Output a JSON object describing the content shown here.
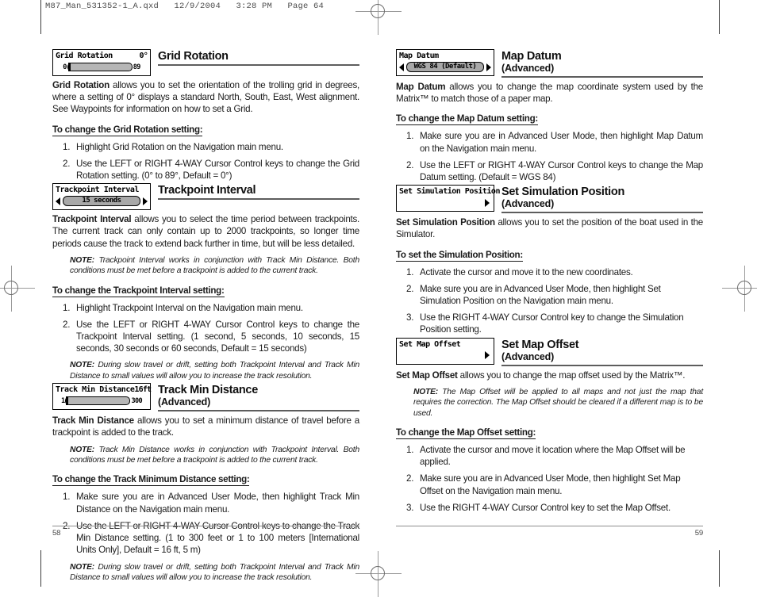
{
  "prepress": {
    "header": "M87_Man_531352-1_A.qxd   12/9/2004   3:28 PM   Page 64"
  },
  "left_page": {
    "page_number": "58",
    "sections": [
      {
        "heading": "Grid Rotation",
        "subheading": "",
        "lcd": {
          "type": "slider",
          "label": "Grid Rotation",
          "value": "0°",
          "min": "0",
          "max": "89"
        },
        "body": [
          "Grid Rotation allows you to set the orientation of the trolling grid in degrees, where a setting of 0° displays a standard North, South, East, West alignment. See Waypoints for information on how to set a Grid."
        ],
        "body_bold_lead": "Grid Rotation",
        "notes_before_procedure": [],
        "procedure_title": "To change the Grid Rotation setting:",
        "steps": [
          "Highlight Grid Rotation on the Navigation main menu.",
          "Use the LEFT or RIGHT 4-WAY Cursor Control keys to change the Grid Rotation setting. (0° to 89°, Default = 0°)"
        ],
        "notes_after": []
      },
      {
        "heading": "Trackpoint Interval",
        "subheading": "",
        "lcd": {
          "type": "select",
          "label": "Trackpoint Interval",
          "value": "15 seconds"
        },
        "body": [
          "Trackpoint Interval allows you to select the time period between trackpoints.  The current track can only contain up to 2000 trackpoints, so longer time periods cause the track to extend back further in time, but will be less detailed."
        ],
        "body_bold_lead": "Trackpoint Interval",
        "notes_before_procedure": [
          "NOTE: Trackpoint Interval works in conjunction with Track Min Distance.  Both conditions must be met before a trackpoint is added to the current track."
        ],
        "procedure_title": "To change the Trackpoint Interval setting:",
        "steps": [
          "Highlight Trackpoint Interval on the Navigation main menu.",
          "Use the LEFT or RIGHT 4-WAY Cursor Control keys to change the Trackpoint Interval setting. (1 second, 5 seconds, 10 seconds, 15 seconds, 30 seconds or 60 seconds, Default = 15 seconds)"
        ],
        "notes_after": [
          "NOTE: During slow travel or drift, setting both Trackpoint Interval and Track Min Distance to small values will allow you to increase the track resolution."
        ]
      },
      {
        "heading": "Track Min Distance",
        "subheading": "(Advanced)",
        "lcd": {
          "type": "slider",
          "label": "Track Min Distance",
          "value": "16ft",
          "min": "1",
          "max": "300"
        },
        "body": [
          "Track Min Distance allows you to set a minimum distance of travel before a trackpoint is added to the track."
        ],
        "body_bold_lead": "Track Min Distance",
        "notes_before_procedure": [
          "NOTE: Track Min Distance works in conjunction with Trackpoint Interval.  Both conditions must be met before a trackpoint is added to the current track."
        ],
        "procedure_title": "To change the Track Minimum Distance setting:",
        "steps": [
          "Make sure you are in Advanced User Mode, then highlight Track Min Distance on the Navigation main menu.",
          "Use the LEFT or RIGHT 4-WAY Cursor Control keys to change the Track Min Distance setting. (1 to 300 feet or 1 to 100 meters [International Units Only], Default = 16 ft, 5 m)"
        ],
        "notes_after": [
          "NOTE: During slow travel or drift, setting both Trackpoint Interval and Track Min Distance to small values will allow you to increase the track resolution."
        ]
      }
    ]
  },
  "right_page": {
    "page_number": "59",
    "sections": [
      {
        "heading": "Map Datum",
        "subheading": "(Advanced)",
        "lcd": {
          "type": "select",
          "label": "Map Datum",
          "value": "WGS 84 (Default)"
        },
        "body": [
          "Map Datum allows you to change the map coordinate system used by the Matrix™ to match those of a paper map."
        ],
        "body_bold_lead": "Map Datum",
        "notes_before_procedure": [],
        "procedure_title": "To change the Map Datum setting:",
        "steps": [
          "Make sure you are in Advanced User Mode, then highlight Map Datum on the Navigation main menu.",
          "Use the LEFT or RIGHT 4-WAY Cursor Control keys to change the Map Datum setting. (Default = WGS 84)"
        ],
        "notes_after": []
      },
      {
        "heading": "Set Simulation Position",
        "subheading": "(Advanced)",
        "lcd": {
          "type": "enter",
          "label": "Set Simulation Position",
          "value": ""
        },
        "body": [
          "Set Simulation Position allows you to set the position of the boat used in the Simulator."
        ],
        "body_bold_lead": "Set Simulation Position",
        "notes_before_procedure": [],
        "procedure_title": "To set the Simulation Position:",
        "steps": [
          "Activate the cursor and move it to the new coordinates.",
          "Make sure you are in Advanced User Mode, then highlight Set Simulation Position on the Navigation main menu.",
          "Use the RIGHT 4-WAY Cursor Control key to change the Simulation Position setting."
        ],
        "notes_after": []
      },
      {
        "heading": "Set Map Offset",
        "subheading": "(Advanced)",
        "lcd": {
          "type": "enter",
          "label": "Set Map Offset",
          "value": ""
        },
        "body": [
          "Set Map Offset allows you to change the map offset used by the Matrix™."
        ],
        "body_bold_lead": "Set Map Offset",
        "notes_before_procedure": [
          "NOTE: The Map Offset will be applied to all maps and not just the map that requires the correction. The Map Offset should be cleared if a different map is to be used."
        ],
        "procedure_title": "To change the Map Offset setting:",
        "steps": [
          "Activate the cursor and move it location where the Map Offset will be applied.",
          "Make sure you are in Advanced User Mode, then highlight Set Map Offset on the Navigation main menu.",
          "Use the RIGHT 4-WAY Cursor Control key to set the Map Offset."
        ],
        "notes_after": []
      }
    ]
  }
}
